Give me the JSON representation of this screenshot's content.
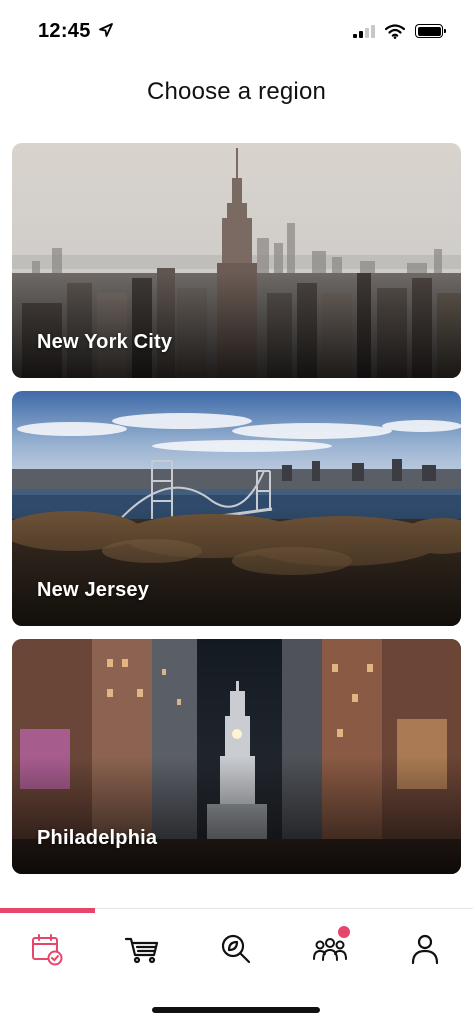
{
  "status_bar": {
    "time": "12:45",
    "icons": [
      "location-arrow-icon",
      "cellular-signal-icon",
      "wifi-icon",
      "battery-icon"
    ]
  },
  "header": {
    "title": "Choose a region"
  },
  "regions": [
    {
      "label": "New York City",
      "image": "new-york-skyline-photo"
    },
    {
      "label": "New Jersey",
      "image": "george-washington-bridge-photo"
    },
    {
      "label": "Philadelphia",
      "image": "philadelphia-city-hall-photo"
    }
  ],
  "tab_bar": {
    "active_index": 0,
    "accent_color": "#e8456a",
    "tabs": [
      {
        "name": "calendar-check-icon"
      },
      {
        "name": "cart-icon"
      },
      {
        "name": "search-leaf-icon"
      },
      {
        "name": "group-icon",
        "has_badge": true
      },
      {
        "name": "profile-icon"
      }
    ]
  }
}
